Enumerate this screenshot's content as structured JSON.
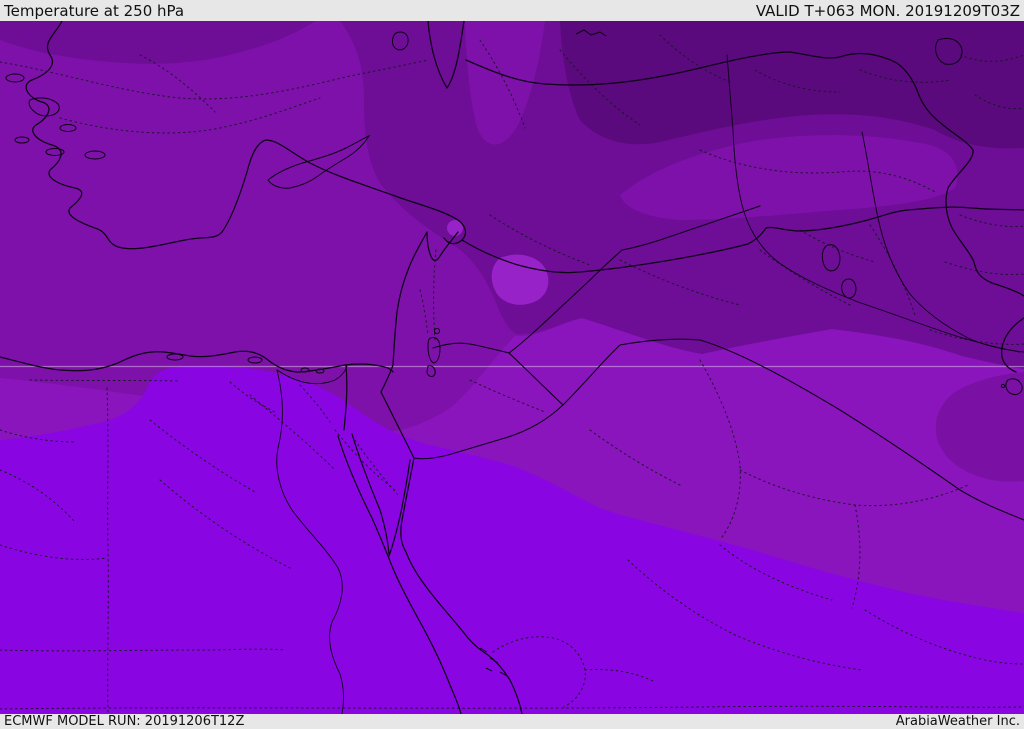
{
  "header": {
    "title": "Temperature at 250 hPa",
    "valid": "VALID T+063 MON. 20191209T03Z"
  },
  "footer": {
    "model_run": "ECMWF MODEL RUN: 20191206T12Z",
    "brand": "ArabiaWeather Inc."
  },
  "palette": {
    "bar_bg": "#e7e7e7",
    "bar_text": "#111111",
    "temp_coldest": "#5a0a7c",
    "temp_colder": "#6e0d96",
    "temp_cold_mid": "#7a11a4",
    "temp_medium": "#7e11aa",
    "temp_mild": "#8a15bc",
    "temp_warm_spot": "#9722c8",
    "temp_warmest": "#8906e2",
    "coastline": "#0d0116",
    "admin_border": "#1f1430",
    "river": "#0d0116",
    "latitude_line": "rgba(255,255,255,0.38)"
  }
}
